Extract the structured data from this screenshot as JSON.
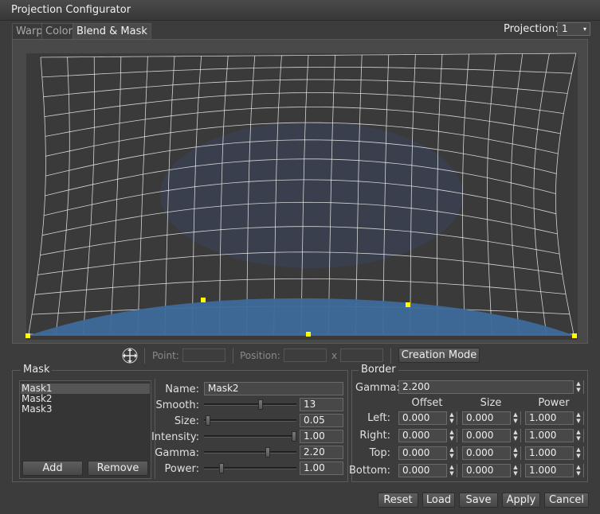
{
  "window": {
    "title": "Projection Configurator"
  },
  "tabs": [
    {
      "label": "Warp",
      "active": false
    },
    {
      "label": "Color",
      "active": false
    },
    {
      "label": "Blend & Mask",
      "active": true
    }
  ],
  "projection": {
    "label": "Projection:",
    "value": "1"
  },
  "toolbar": {
    "move_icon": "four-way-arrow-icon",
    "point_label": "Point:",
    "point_value": "",
    "position_label": "Position:",
    "position_x": "",
    "x_sep": "x",
    "position_y": "",
    "creation_mode_label": "Creation Mode"
  },
  "mask": {
    "group_label": "Mask",
    "items": [
      {
        "label": "Mask1",
        "selected": true
      },
      {
        "label": "Mask2",
        "selected": false
      },
      {
        "label": "Mask3",
        "selected": false
      }
    ],
    "add_label": "Add",
    "remove_label": "Remove",
    "properties": {
      "name_label": "Name:",
      "name_value": "Mask2",
      "smooth_label": "Smooth:",
      "smooth_value": "13",
      "smooth_fraction": 0.62,
      "size_label": "Size:",
      "size_value": "0.05",
      "size_fraction": 0.02,
      "intensity_label": "Intensity:",
      "intensity_value": "1.00",
      "intensity_fraction": 1.0,
      "gamma_label": "Gamma:",
      "gamma_value": "2.20",
      "gamma_fraction": 0.7,
      "power_label": "Power:",
      "power_value": "1.00",
      "power_fraction": 0.17
    }
  },
  "border": {
    "group_label": "Border",
    "gamma_label": "Gamma:",
    "gamma_value": "2.200",
    "columns": [
      "Offset",
      "Size",
      "Power"
    ],
    "rows": [
      {
        "label": "Left:",
        "offset": "0.000",
        "size": "0.000",
        "power": "1.000"
      },
      {
        "label": "Right:",
        "offset": "0.000",
        "size": "0.000",
        "power": "1.000"
      },
      {
        "label": "Top:",
        "offset": "0.000",
        "size": "0.000",
        "power": "1.000"
      },
      {
        "label": "Bottom:",
        "offset": "0.000",
        "size": "0.000",
        "power": "1.000"
      }
    ]
  },
  "footer": {
    "reset_label": "Reset",
    "load_label": "Load",
    "save_label": "Save",
    "apply_label": "Apply",
    "cancel_label": "Cancel"
  },
  "colors": {
    "mask_fill": "#3d6a9a",
    "shadow_fill": "#3a4150",
    "control_point": "#ffff00",
    "grid_line": "#f0f0f0"
  }
}
